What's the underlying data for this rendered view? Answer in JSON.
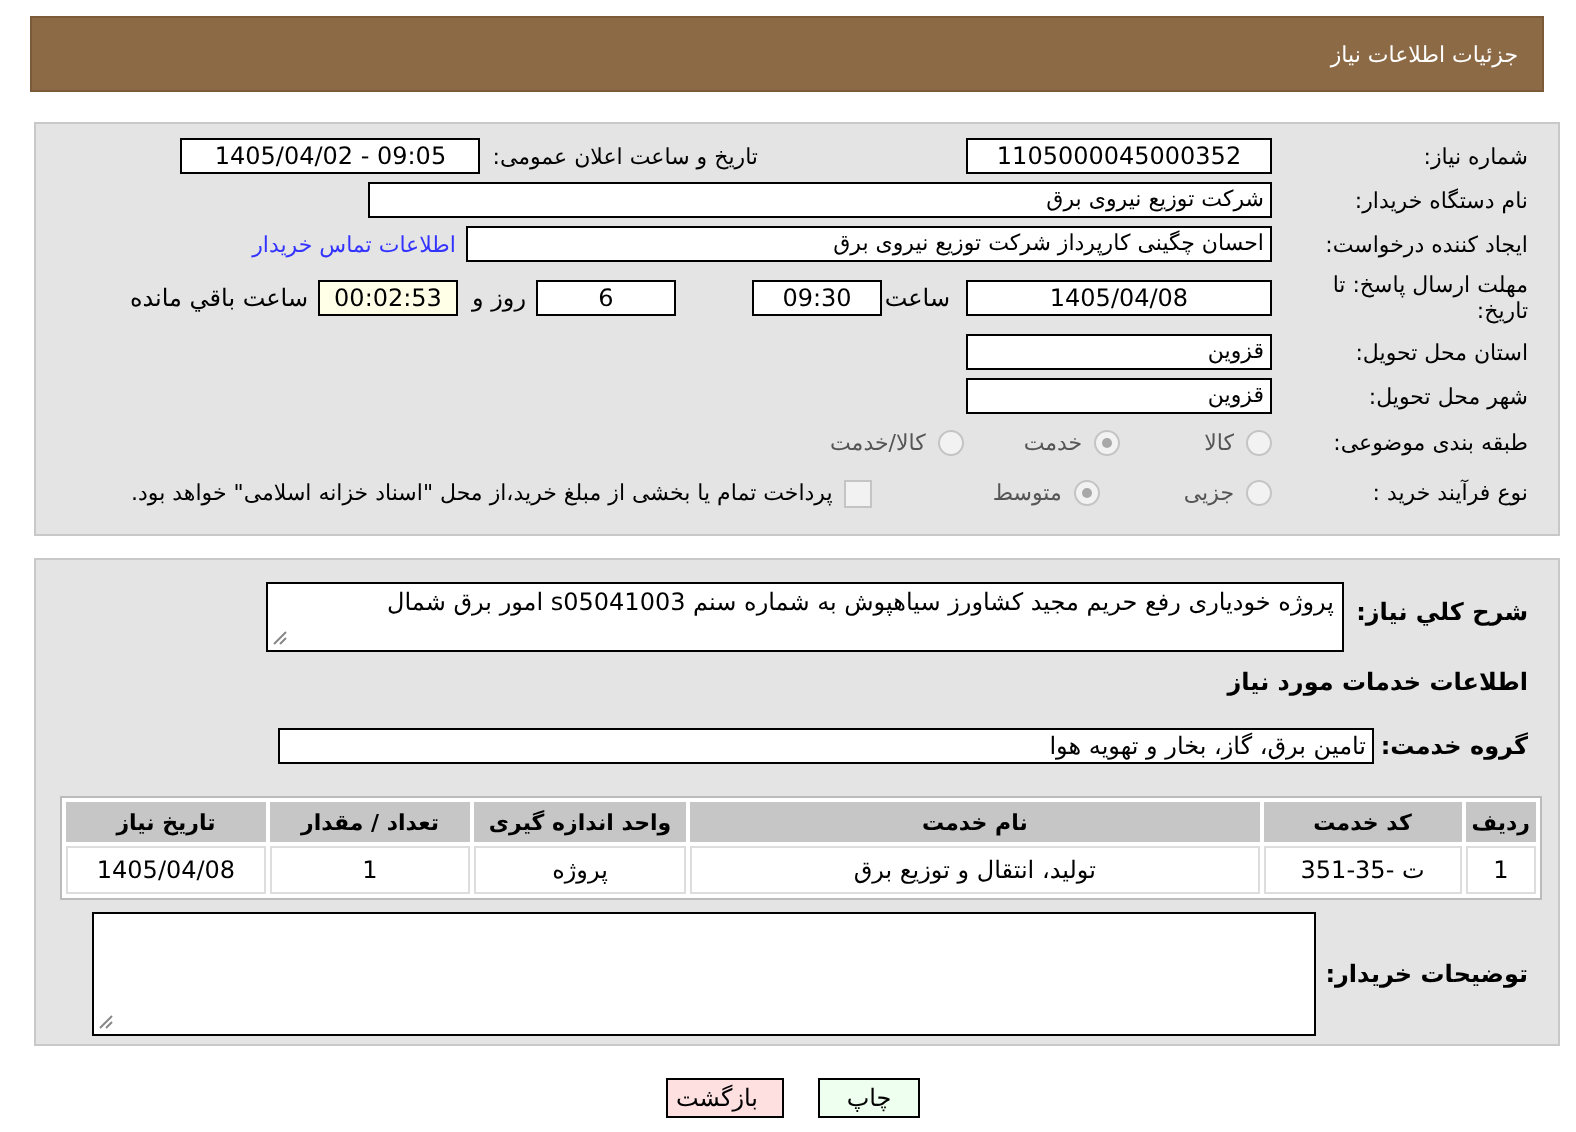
{
  "header": {
    "title": "جزئیات اطلاعات نیاز"
  },
  "need_number": {
    "label": "شماره نیاز:",
    "value": "1105000045000352"
  },
  "announce": {
    "label": "تاریخ و ساعت اعلان عمومی:",
    "value": "1405/04/02 - 09:05"
  },
  "buyer": {
    "label": "نام دستگاه خریدار:",
    "value": "شرکت توزیع نیروی برق"
  },
  "creator": {
    "label": "ایجاد کننده درخواست:",
    "value": "احسان چگینی کارپرداز شرکت توزیع نیروی برق",
    "link": "اطلاعات تماس خریدار"
  },
  "deadline": {
    "label": "مهلت ارسال پاسخ: تا تاریخ:",
    "date": "1405/04/08",
    "time_label": "ساعت",
    "time": "09:30",
    "days": "6",
    "days_label": "روز و",
    "remaining": "00:02:53",
    "remaining_label": "ساعت باقي مانده"
  },
  "province": {
    "label": "استان محل تحویل:",
    "value": "قزوین"
  },
  "city": {
    "label": "شهر محل تحویل:",
    "value": "قزوین"
  },
  "category": {
    "label": "طبقه بندی موضوعی:",
    "options": [
      {
        "label": "کالا",
        "selected": false
      },
      {
        "label": "خدمت",
        "selected": true
      },
      {
        "label": "کالا/خدمت",
        "selected": false
      }
    ]
  },
  "purchase_type": {
    "label": "نوع فرآیند خرید :",
    "options": [
      {
        "label": "جزیی",
        "selected": false
      },
      {
        "label": "متوسط",
        "selected": true
      }
    ],
    "payment": {
      "checked": false,
      "text": "پرداخت تمام یا بخشی از مبلغ خرید،از محل \"اسناد خزانه اسلامی\" خواهد بود."
    }
  },
  "description": {
    "label": "شرح کلي نياز:",
    "value": "پروژه خودیاری رفع حریم مجید کشاورز سیاهپوش  به شماره سنم s05041003 امور برق شمال"
  },
  "services_title": "اطلاعات خدمات مورد نياز",
  "service_group": {
    "label": "گروه خدمت:",
    "value": "تامین برق، گاز، بخار و تهویه هوا"
  },
  "table": {
    "columns": [
      "ردیف",
      "کد خدمت",
      "نام خدمت",
      "واحد اندازه گیری",
      "تعداد / مقدار",
      "تاریخ نیاز"
    ],
    "rows": [
      [
        "1",
        "ت -35-351",
        "تولید، انتقال و توزیع برق",
        "پروژه",
        "1",
        "1405/04/08"
      ]
    ]
  },
  "buyer_notes": {
    "label": "توضیحات خریدار:"
  },
  "buttons": [
    {
      "label": "چاپ",
      "kind": "print"
    },
    {
      "label": "بازگشت",
      "kind": "back"
    }
  ]
}
